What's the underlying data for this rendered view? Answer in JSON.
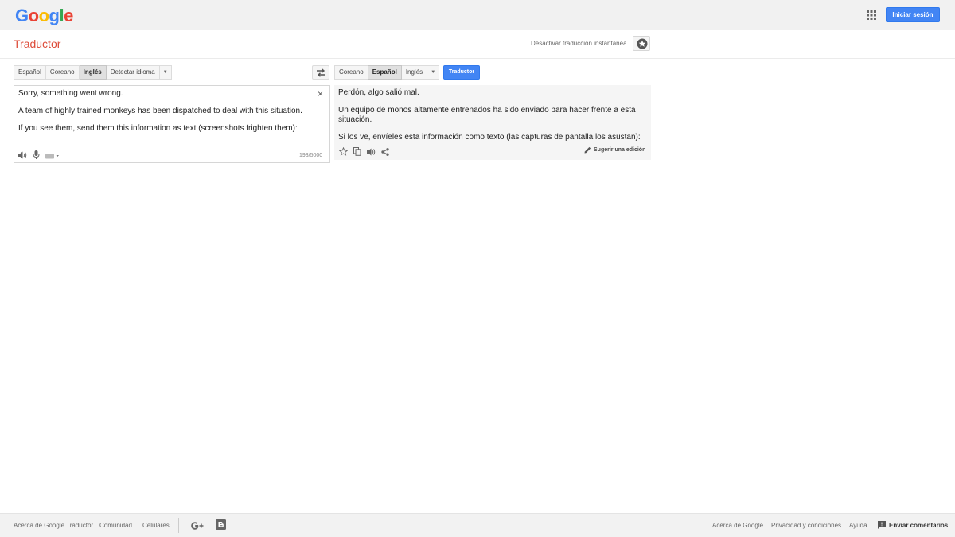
{
  "header": {
    "logo_letters": [
      {
        "char": "G",
        "color": "#4285f4"
      },
      {
        "char": "o",
        "color": "#ea4335"
      },
      {
        "char": "o",
        "color": "#fbbc05"
      },
      {
        "char": "g",
        "color": "#4285f4"
      },
      {
        "char": "l",
        "color": "#34a853"
      },
      {
        "char": "e",
        "color": "#ea4335"
      }
    ],
    "apps_icon": "apps-grid-icon",
    "signin_label": "Iniciar sesión"
  },
  "subheader": {
    "title": "Traductor",
    "instant_toggle": "Desactivar traducción instantánea",
    "star_icon": "star-icon"
  },
  "source": {
    "langs": [
      "Español",
      "Coreano",
      "Inglés",
      "Detectar idioma"
    ],
    "active_index": 2,
    "paragraphs": [
      "Sorry, something went wrong.",
      "A team of highly trained monkeys has been dispatched to deal with this situation.",
      "If you see them, send them this information as text (screenshots frighten them):"
    ],
    "char_count": "193/5000",
    "clear_symbol": "×",
    "tools": [
      "speaker-icon",
      "microphone-icon",
      "keyboard-icon"
    ]
  },
  "target": {
    "langs": [
      "Coreano",
      "Español",
      "Inglés"
    ],
    "active_index": 1,
    "translate_label": "Traductor",
    "paragraphs": [
      "Perdón, algo salió mal.",
      "Un equipo de monos altamente entrenados ha sido enviado para hacer frente a esta situación.",
      "Si los ve, envíeles esta información como texto (las capturas de pantalla los asustan):"
    ],
    "suggest_label": "Sugerir una edición",
    "tools": [
      "star-outline-icon",
      "copy-icon",
      "speaker-icon",
      "share-icon"
    ]
  },
  "footer": {
    "left_links": [
      "Acerca de Google Traductor",
      "Comunidad",
      "Celulares"
    ],
    "right_links": [
      "Acerca de Google",
      "Privacidad y condiciones",
      "Ayuda"
    ],
    "feedback_label": "Enviar comentarios",
    "social_icons": [
      "google-plus-icon",
      "blogger-icon"
    ]
  },
  "colors": {
    "accent_blue": "#4285f4",
    "title_red": "#dd4b39",
    "topbar_bg": "#f1f1f1"
  }
}
